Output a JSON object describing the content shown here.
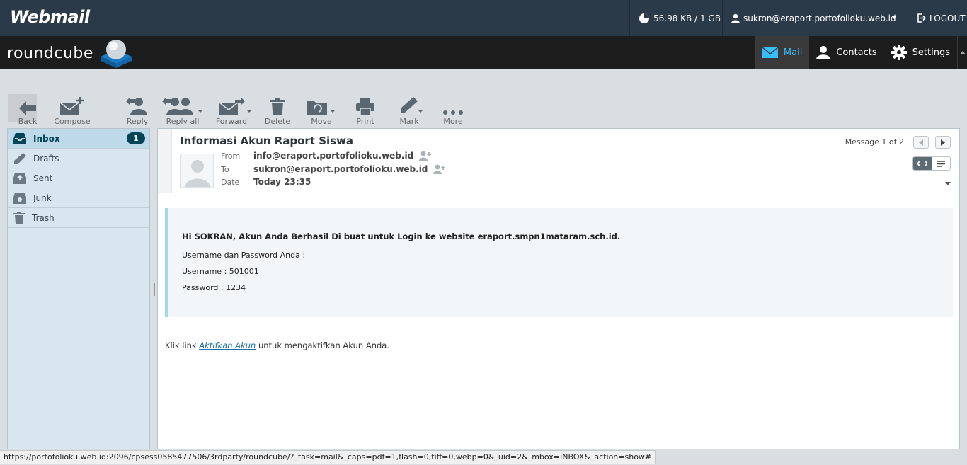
{
  "topbar": {
    "brand": "Webmail",
    "quota": "56.98 KB / 1 GB",
    "user": "sukron@eraport.portofolioku.web.id",
    "logout": "LOGOUT"
  },
  "header": {
    "logo_text": "roundcube",
    "nav": [
      {
        "label": "Mail",
        "icon": "envelope-icon",
        "active": true
      },
      {
        "label": "Contacts",
        "icon": "person-icon"
      },
      {
        "label": "Settings",
        "icon": "gear-icon"
      }
    ]
  },
  "toolbar": {
    "back": "Back",
    "compose": "Compose",
    "reply": "Reply",
    "reply_all": "Reply all",
    "forward": "Forward",
    "delete": "Delete",
    "move": "Move",
    "print": "Print",
    "mark": "Mark",
    "more": "More"
  },
  "folders": [
    {
      "label": "Inbox",
      "icon": "inbox-icon",
      "unread": "1"
    },
    {
      "label": "Drafts",
      "icon": "pencil-icon"
    },
    {
      "label": "Sent",
      "icon": "sent-icon"
    },
    {
      "label": "Junk",
      "icon": "junk-icon"
    },
    {
      "label": "Trash",
      "icon": "trash-icon"
    }
  ],
  "message": {
    "subject": "Informasi Akun Raport Siswa",
    "from_label": "From",
    "from": "info@eraport.portofolioku.web.id",
    "to_label": "To",
    "to": "sukron@eraport.portofolioku.web.id",
    "date_label": "Date",
    "date": "Today 23:35",
    "count": "Message 1 of 2",
    "body": {
      "greeting": "Hi SOKRAN, Akun Anda Berhasil Di buat untuk Login ke website eraport.smpn1mataram.sch.id.",
      "line1": "Username dan Password Anda :",
      "line2": "Username : 501001",
      "line3": "Password : 1234"
    },
    "closing_before": "Klik link ",
    "closing_link": "Aktifkan Akun",
    "closing_after": " untuk mengaktifkan Akun Anda."
  },
  "status_url": "https://portofolioku.web.id:2096/cpsess0585477506/3rdparty/roundcube/?_task=mail&_caps=pdf=1,flash=0,tiff=0,webp=0&_uid=2&_mbox=INBOX&_action=show#"
}
